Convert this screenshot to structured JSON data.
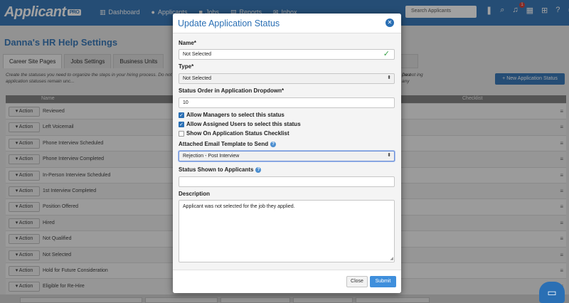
{
  "app": {
    "logo": "Applicant",
    "logo_badge": "PRO",
    "nav": [
      {
        "label": "Dashboard",
        "icon": "dashboard-icon"
      },
      {
        "label": "Applicants",
        "icon": "users-icon"
      },
      {
        "label": "Jobs",
        "icon": "briefcase-icon"
      },
      {
        "label": "Reports",
        "icon": "reports-icon"
      },
      {
        "label": "Inbox",
        "icon": "inbox-icon"
      }
    ],
    "search_placeholder": "Search Applicants",
    "notification_count": "1"
  },
  "page": {
    "title": "Danna's HR Help Settings",
    "tabs": [
      "Career Site Pages",
      "Jobs Settings",
      "Business Units"
    ],
    "active_tab": "Career Site Pages",
    "description": "Create the statuses you need to organize the steps in your hiring process. Do not change the titles to something with a different meaning. If you need to ... any no longer needed. This will ensure past application statuses remain unc...",
    "description_right": "Do not ing any",
    "new_status_button": "New Application Status",
    "table_headers": {
      "name": "Name",
      "checklist": "Checklist"
    },
    "action_label": "Action",
    "rows": [
      "Reviewed",
      "Left Voicemail",
      "Phone Interview Scheduled",
      "Phone Interview Completed",
      "In-Person Interview Scheduled",
      "1st Interview Completed",
      "Position Offered",
      "Hired",
      "Not Qualified",
      "Not Selected",
      "Hold for Future Consideration",
      "Eligible for Re-Hire"
    ]
  },
  "modal": {
    "title": "Update Application Status",
    "name_label": "Name*",
    "name_value": "Not Selected",
    "type_label": "Type*",
    "type_value": "Not Selected",
    "order_label": "Status Order in Application Dropdown*",
    "order_value": "10",
    "checkboxes": [
      {
        "label": "Allow Managers to select this status",
        "checked": true
      },
      {
        "label": "Allow Assigned Users to select this status",
        "checked": true
      },
      {
        "label": "Show On Application Status Checklist",
        "checked": false
      }
    ],
    "email_template_label": "Attached Email Template to Send",
    "email_template_value": "Rejection - Post Interview",
    "shown_to_applicants_label": "Status Shown to Applicants",
    "shown_to_applicants_value": "",
    "description_label": "Description",
    "description_value": "Applicant was not selected for the job they applied.",
    "close_button": "Close",
    "submit_button": "Submit"
  },
  "colors": {
    "brand": "#2a6fb4",
    "submit": "#3f8fdc",
    "valid": "#3aa34a"
  }
}
